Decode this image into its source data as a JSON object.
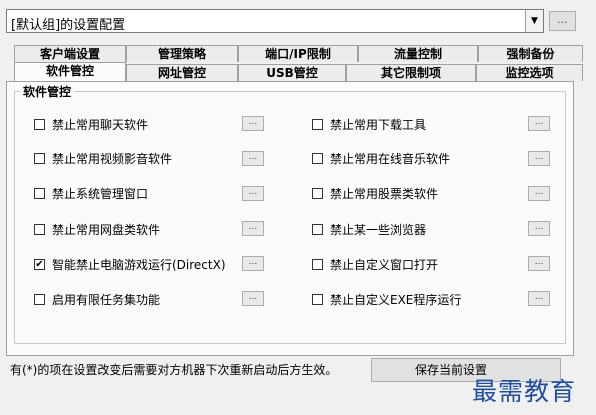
{
  "config_combo": {
    "value": "[默认组]的设置配置",
    "ellipsis": "..."
  },
  "tabs_row1": [
    "客户端设置",
    "管理策略",
    "端口/IP限制",
    "流量控制",
    "强制备份"
  ],
  "tabs_row2": [
    "软件管控",
    "网址管控",
    "USB管控",
    "其它限制项",
    "监控选项"
  ],
  "active_tab": "软件管控",
  "group": {
    "title": "软件管控",
    "left_options": [
      {
        "label": "禁止常用聊天软件",
        "checked": false
      },
      {
        "label": "禁止常用视频影音软件",
        "checked": false
      },
      {
        "label": "禁止系统管理窗口",
        "checked": false
      },
      {
        "label": "禁止常用网盘类软件",
        "checked": false
      },
      {
        "label": "智能禁止电脑游戏运行(DirectX)",
        "checked": true
      },
      {
        "label": "启用有限任务集功能",
        "checked": false
      }
    ],
    "right_options": [
      {
        "label": "禁止常用下载工具",
        "checked": false
      },
      {
        "label": "禁止常用在线音乐软件",
        "checked": false
      },
      {
        "label": "禁止常用股票类软件",
        "checked": false
      },
      {
        "label": "禁止某一些浏览器",
        "checked": false
      },
      {
        "label": "禁止自定义窗口打开",
        "checked": false
      },
      {
        "label": "禁止自定义EXE程序运行",
        "checked": false
      }
    ],
    "option_button": "..."
  },
  "footer": {
    "note": "有(*)的项在设置改变后需要对方机器下次重新启动后方生效。",
    "save_button": "保存当前设置"
  },
  "watermark": "最需教育",
  "check_mark": "✔"
}
